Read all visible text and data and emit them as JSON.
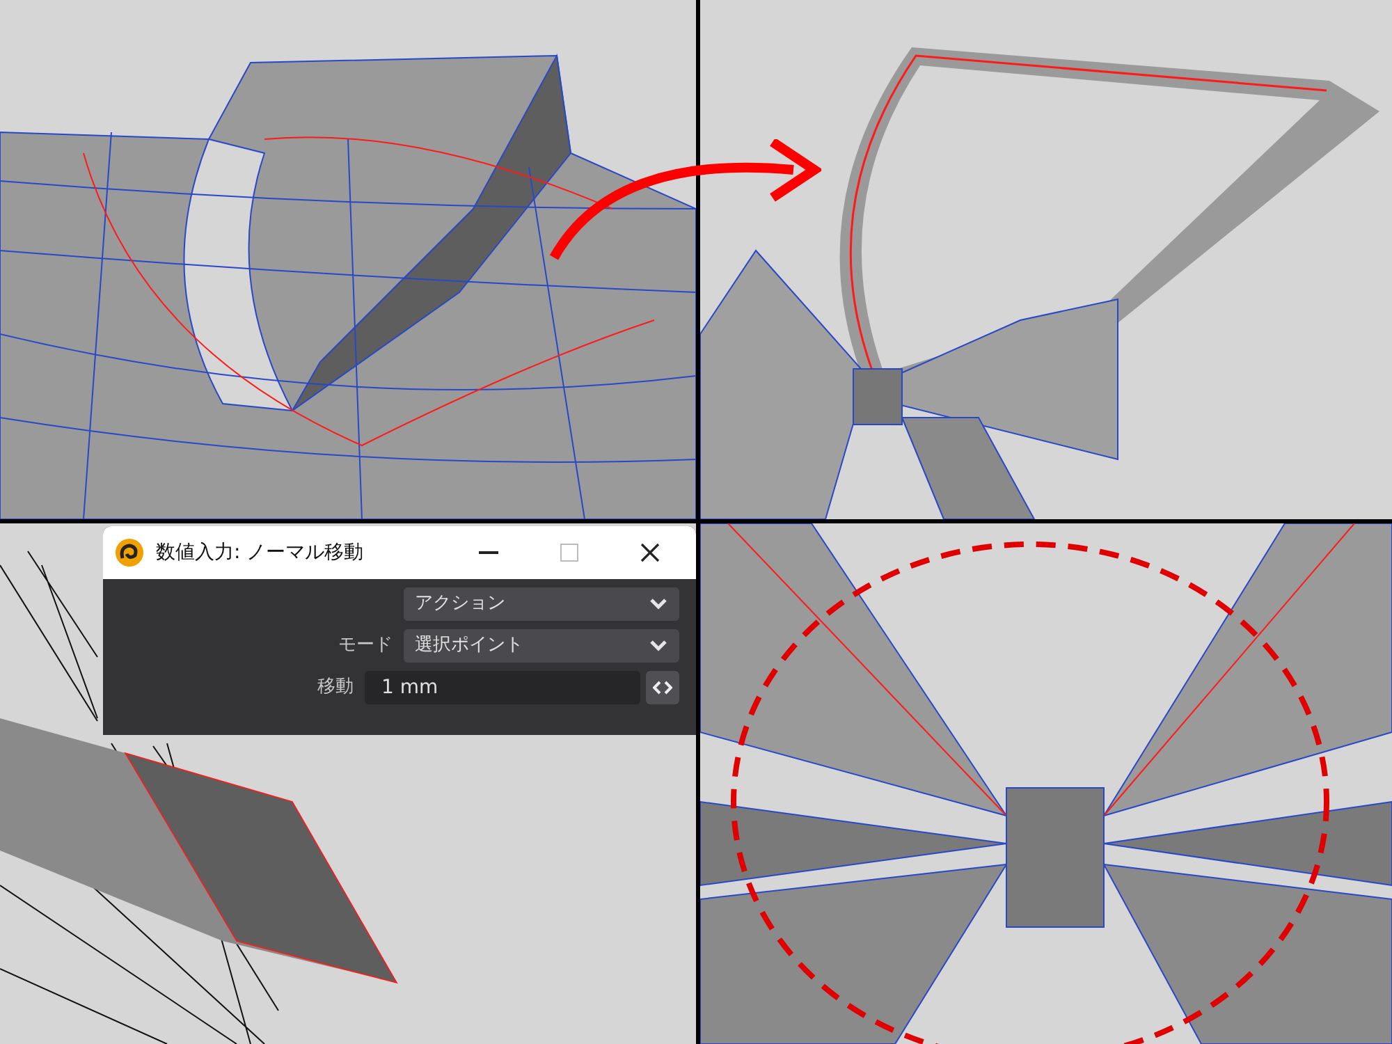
{
  "dialog": {
    "title": "数値入力: ノーマル移動",
    "fields": [
      {
        "kind": "dropdown",
        "value": "アクション"
      },
      {
        "kind": "dropdown",
        "label": "モード",
        "value": "選択ポイント"
      },
      {
        "kind": "number",
        "label": "移動",
        "value": "1 mm"
      }
    ]
  }
}
